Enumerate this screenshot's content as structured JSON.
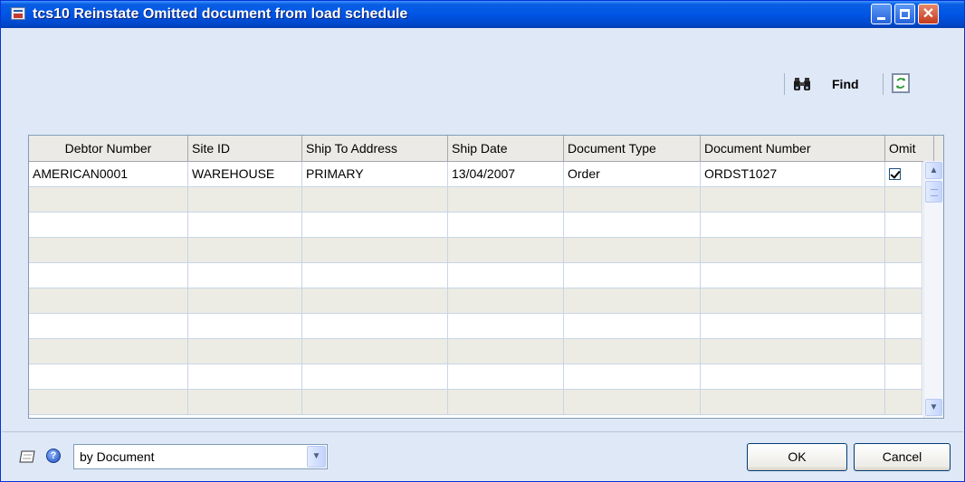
{
  "window": {
    "title": "tcs10 Reinstate Omitted document from load schedule"
  },
  "toolbar": {
    "find_label": "Find"
  },
  "grid": {
    "columns": [
      "Debtor Number",
      "Site ID",
      "Ship To Address",
      "Ship Date",
      "Document Type",
      "Document Number",
      "Omit"
    ],
    "rows": [
      {
        "debtor_number": "AMERICAN0001",
        "site_id": "WAREHOUSE",
        "ship_to_address": "PRIMARY",
        "ship_date": "13/04/2007",
        "document_type": "Order",
        "document_number": "ORDST1027",
        "omit": true
      }
    ]
  },
  "footer": {
    "sort_by": "by Document",
    "ok_label": "OK",
    "cancel_label": "Cancel"
  },
  "colors": {
    "title_bar": "#0055e5",
    "window_bg": "#dfe8f6",
    "alt_row": "#ecece4"
  }
}
